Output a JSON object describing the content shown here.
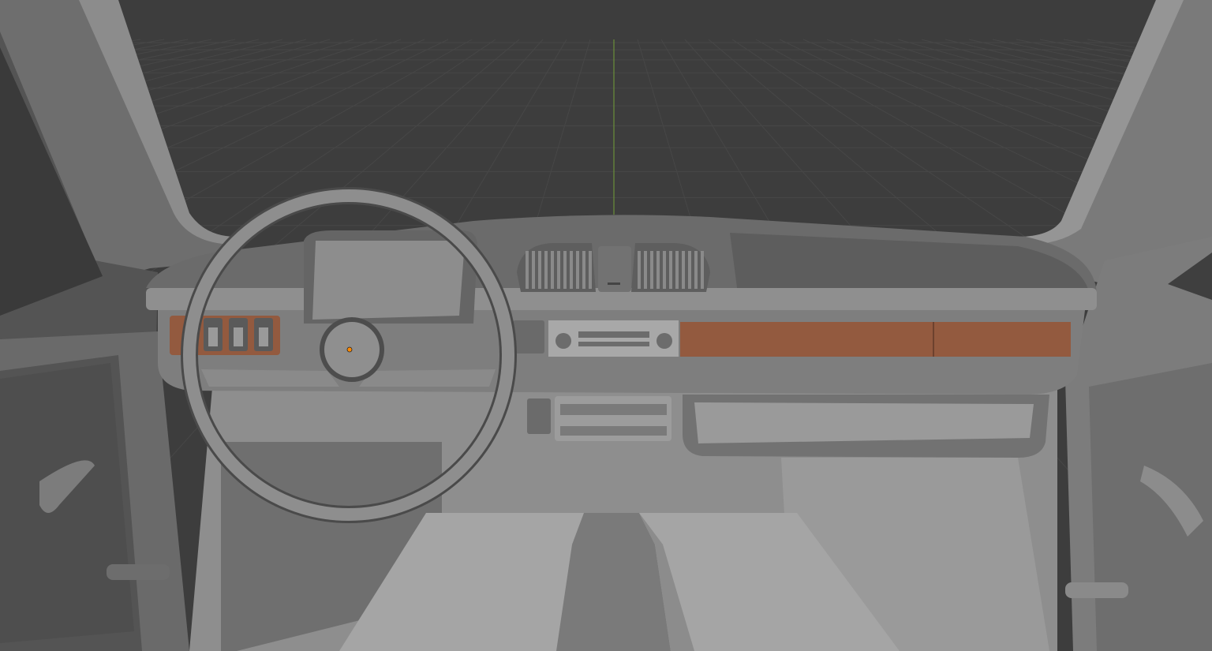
{
  "viewport": {
    "background_color": "#3d3d3d",
    "grid_color": "#474747",
    "axis_y_color": "#6a8f3a",
    "selected_object": "car_interior"
  },
  "materials": {
    "body_gray": "#8a8a8a",
    "dark_gray": "#5c5c5c",
    "light_gray": "#a3a3a3",
    "wood_trim": "#935a3f",
    "origin_dot": "#ff8a00"
  },
  "icons": [
    "origin-point-icon",
    "steering-wheel-icon",
    "air-vent-icon"
  ]
}
